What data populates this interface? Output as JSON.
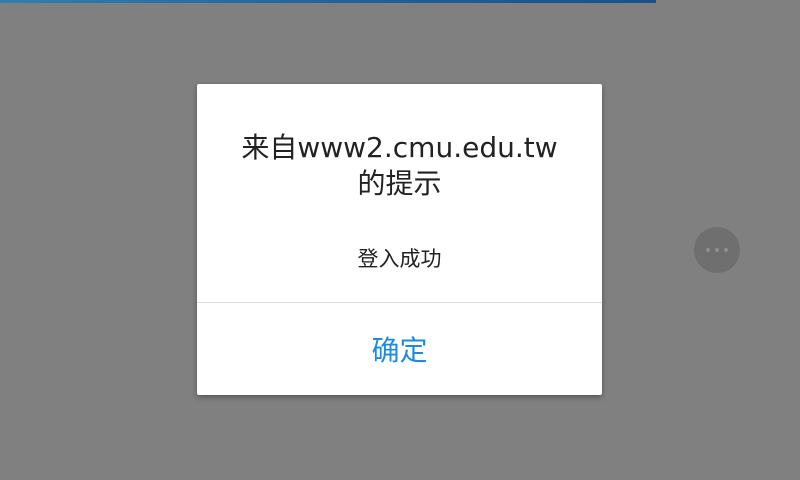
{
  "page_load_progress": {
    "value_percent": 82,
    "color": "#1f5e9a"
  },
  "dialog": {
    "title": "来自www2.cmu.edu.tw的提示",
    "message": "登入成功",
    "confirm_label": "确定",
    "confirm_color": "#1f8bdc"
  },
  "floating_button": {
    "icon": "more-horiz-icon"
  }
}
